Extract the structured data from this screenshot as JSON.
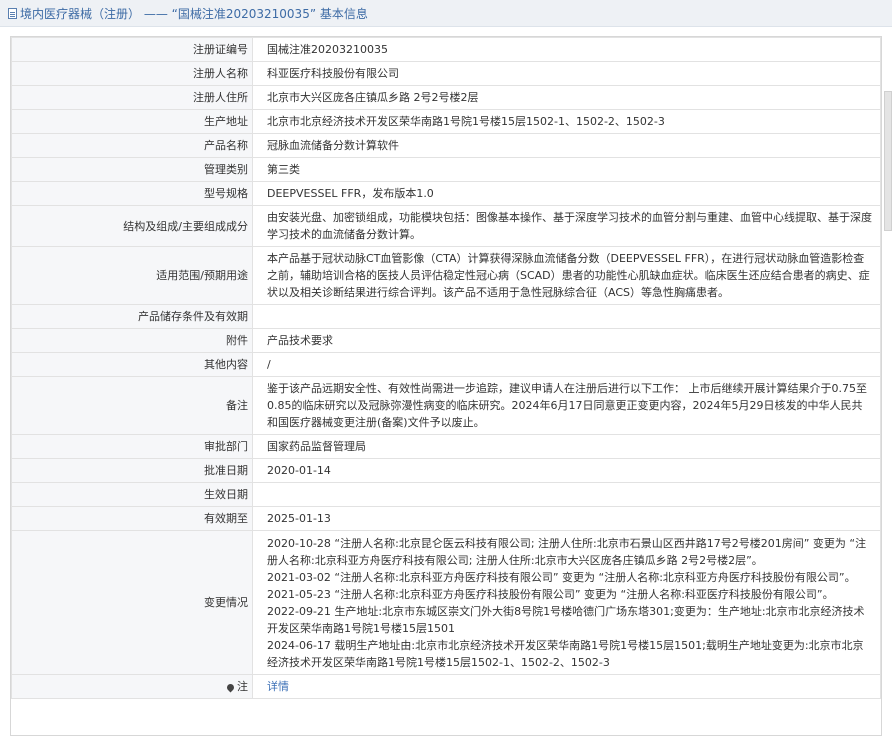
{
  "header": {
    "title": "境内医疗器械（注册） —— “国械注准20203210035” 基本信息"
  },
  "rows": [
    {
      "label": "注册证编号",
      "value": "国械注准20203210035"
    },
    {
      "label": "注册人名称",
      "value": "科亚医疗科技股份有限公司"
    },
    {
      "label": "注册人住所",
      "value": "北京市大兴区庞各庄镇瓜乡路 2号2号楼2层"
    },
    {
      "label": "生产地址",
      "value": "北京市北京经济技术开发区荣华南路1号院1号楼15层1502-1、1502-2、1502-3"
    },
    {
      "label": "产品名称",
      "value": "冠脉血流储备分数计算软件"
    },
    {
      "label": "管理类别",
      "value": "第三类"
    },
    {
      "label": "型号规格",
      "value": "DEEPVESSEL FFR，发布版本1.0"
    },
    {
      "label": "结构及组成/主要组成成分",
      "value": "由安装光盘、加密锁组成，功能模块包括：图像基本操作、基于深度学习技术的血管分割与重建、血管中心线提取、基于深度学习技术的血流储备分数计算。"
    },
    {
      "label": "适用范围/预期用途",
      "value": "本产品基于冠状动脉CT血管影像（CTA）计算获得深脉血流储备分数（DEEPVESSEL FFR），在进行冠状动脉血管造影检查之前，辅助培训合格的医技人员评估稳定性冠心病（SCAD）患者的功能性心肌缺血症状。临床医生还应结合患者的病史、症状以及相关诊断结果进行综合评判。该产品不适用于急性冠脉综合征（ACS）等急性胸痛患者。"
    },
    {
      "label": "产品储存条件及有效期",
      "value": ""
    },
    {
      "label": "附件",
      "value": "产品技术要求"
    },
    {
      "label": "其他内容",
      "value": "/"
    },
    {
      "label": "备注",
      "value": "鉴于该产品远期安全性、有效性尚需进一步追踪，建议申请人在注册后进行以下工作： 上市后继续开展计算结果介于0.75至0.85的临床研究以及冠脉弥漫性病变的临床研究。2024年6月17日同意更正变更内容，2024年5月29日核发的中华人民共和国医疗器械变更注册(备案)文件予以废止。"
    },
    {
      "label": "审批部门",
      "value": "国家药品监督管理局"
    },
    {
      "label": "批准日期",
      "value": "2020-01-14"
    },
    {
      "label": "生效日期",
      "value": ""
    },
    {
      "label": "有效期至",
      "value": "2025-01-13"
    }
  ],
  "changes": {
    "label": "变更情况",
    "items": [
      "2020-10-28 “注册人名称:北京昆仑医云科技有限公司; 注册人住所:北京市石景山区西井路17号2号楼201房间” 变更为 “注册人名称:北京科亚方舟医疗科技有限公司; 注册人住所:北京市大兴区庞各庄镇瓜乡路 2号2号楼2层”。",
      "2021-03-02 “注册人名称:北京科亚方舟医疗科技有限公司” 变更为 “注册人名称:北京科亚方舟医疗科技股份有限公司”。",
      "2021-05-23 “注册人名称:北京科亚方舟医疗科技股份有限公司” 变更为 “注册人名称:科亚医疗科技股份有限公司”。",
      "2022-09-21 生产地址:北京市东城区崇文门外大街8号院1号楼哈德门广场东塔301;变更为：生产地址:北京市北京经济技术开发区荣华南路1号院1号楼15层1501",
      "2024-06-17 载明生产地址由:北京市北京经济技术开发区荣华南路1号院1号楼15层1501;载明生产地址变更为:北京市北京经济技术开发区荣华南路1号院1号楼15层1502-1、1502-2、1502-3"
    ]
  },
  "note": {
    "label": "注",
    "link_text": "详情",
    "icon": "map-pin-icon"
  },
  "colors": {
    "accent": "#3d6ba5",
    "link": "#3b6fb6",
    "label_bg": "#f6f7f9",
    "border": "#e2e2e2"
  }
}
